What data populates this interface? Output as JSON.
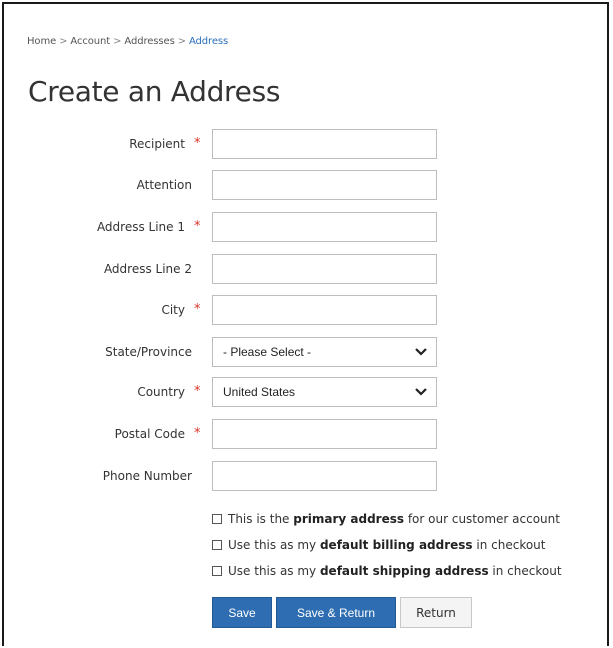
{
  "breadcrumb": {
    "items": [
      "Home",
      "Account",
      "Addresses"
    ],
    "separator": ">",
    "current": "Address"
  },
  "page": {
    "title": "Create an Address"
  },
  "form": {
    "required_marker": "*",
    "recipient_label": "Recipient",
    "attention_label": "Attention",
    "address1_label": "Address Line 1",
    "address2_label": "Address Line 2",
    "city_label": "City",
    "state_label": "State/Province",
    "state_selected": "- Please Select -",
    "country_label": "Country",
    "country_selected": "United States",
    "postal_label": "Postal Code",
    "phone_label": "Phone Number",
    "recipient_value": "",
    "attention_value": "",
    "address1_value": "",
    "address2_value": "",
    "city_value": "",
    "postal_value": "",
    "phone_value": ""
  },
  "checkboxes": {
    "primary": {
      "pre": "This is the ",
      "bold": "primary address",
      "post": " for our customer account",
      "checked": false
    },
    "billing": {
      "pre": "Use this as my ",
      "bold": "default billing address",
      "post": " in checkout",
      "checked": false
    },
    "shipping": {
      "pre": "Use this as my ",
      "bold": "default shipping address",
      "post": " in checkout",
      "checked": false
    }
  },
  "buttons": {
    "save": "Save",
    "save_return": "Save & Return",
    "return": "Return"
  },
  "colors": {
    "primary_button": "#2e6db2",
    "required_star": "#d9332a",
    "breadcrumb_current": "#2a6ebb"
  }
}
